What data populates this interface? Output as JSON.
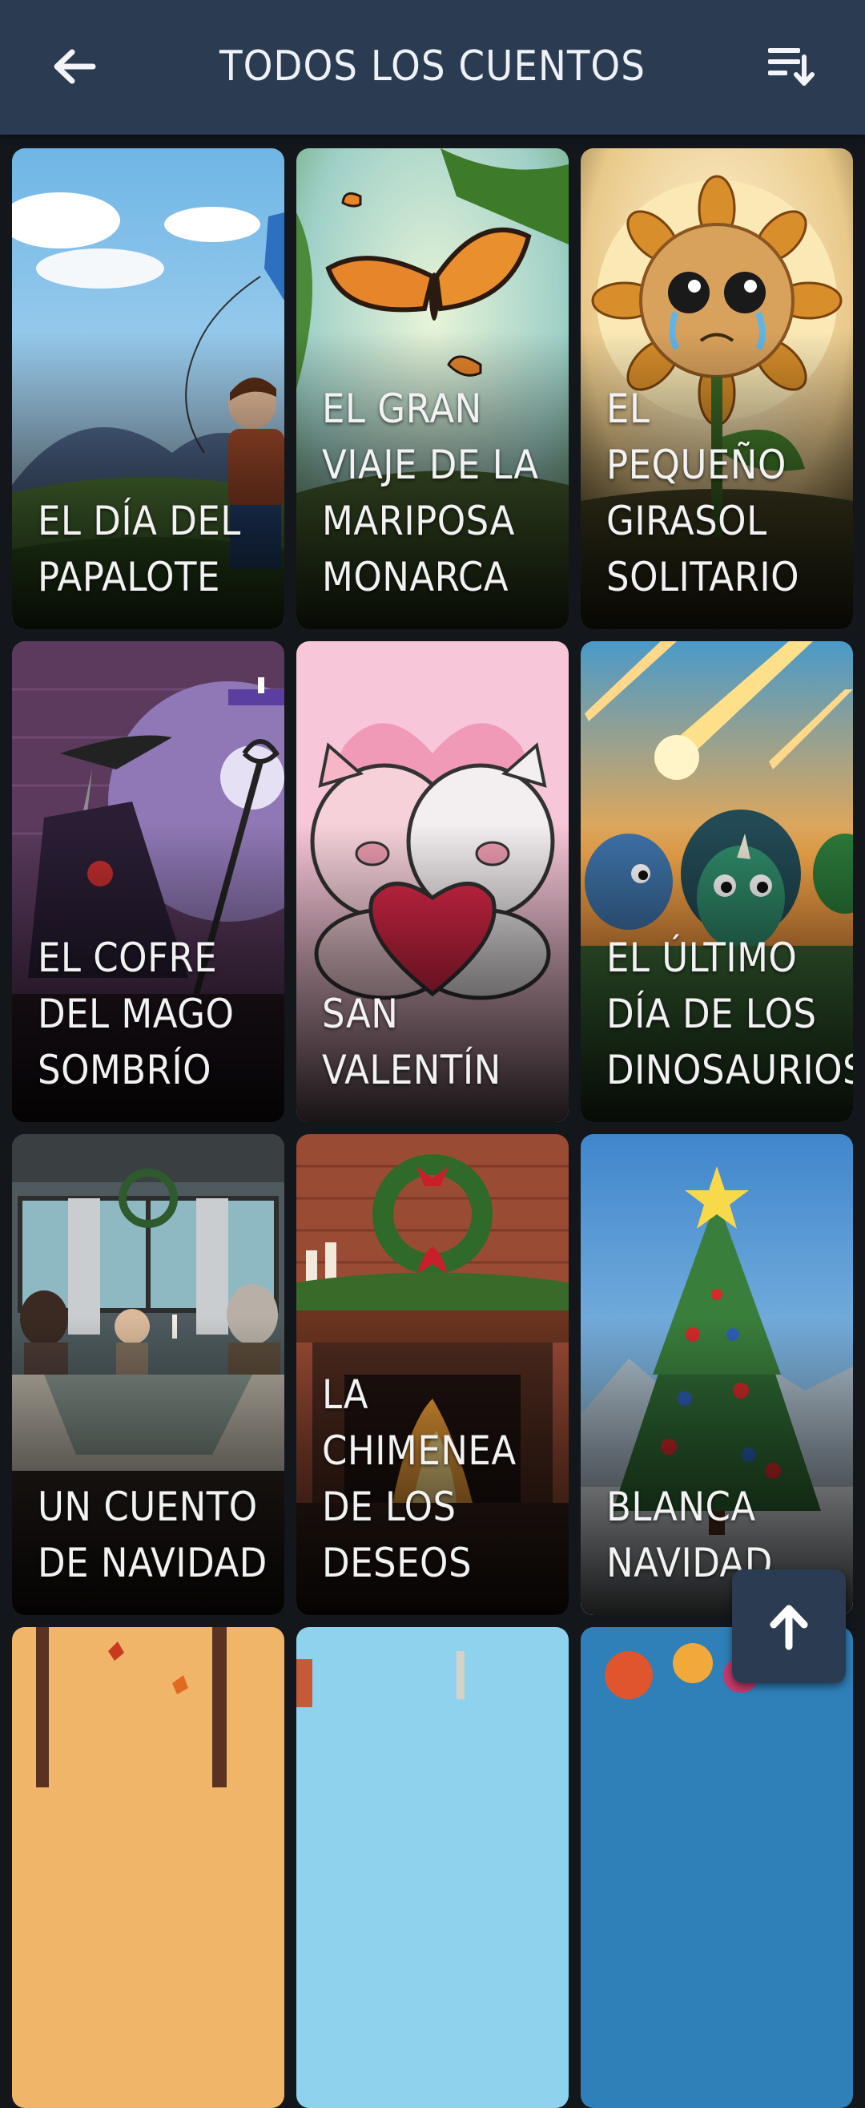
{
  "header": {
    "title": "TODOS LOS CUENTOS",
    "back_icon": "arrow-left-icon",
    "sort_icon": "sort-descending-icon"
  },
  "stories": [
    {
      "title": "EL DÍA DEL PAPALOTE"
    },
    {
      "title": "EL GRAN VIAJE DE LA MARIPOSA MONARCA"
    },
    {
      "title": "EL PEQUEÑO GIRASOL SOLITARIO"
    },
    {
      "title": "EL COFRE DEL MAGO SOMBRÍO"
    },
    {
      "title": "SAN VALENTÍN"
    },
    {
      "title": "EL ÚLTIMO DÍA DE LOS DINOSAURIOS"
    },
    {
      "title": "UN CUENTO DE NAVIDAD"
    },
    {
      "title": "LA CHIMENEA DE LOS DESEOS"
    },
    {
      "title": "BLANCA NAVIDAD"
    },
    {
      "title": ""
    },
    {
      "title": ""
    },
    {
      "title": ""
    }
  ],
  "scroll_top_button": {
    "icon": "arrow-up-icon"
  },
  "colors": {
    "header_bg": "#2b3c52",
    "page_bg": "#13171c",
    "text": "#eef1f5"
  }
}
